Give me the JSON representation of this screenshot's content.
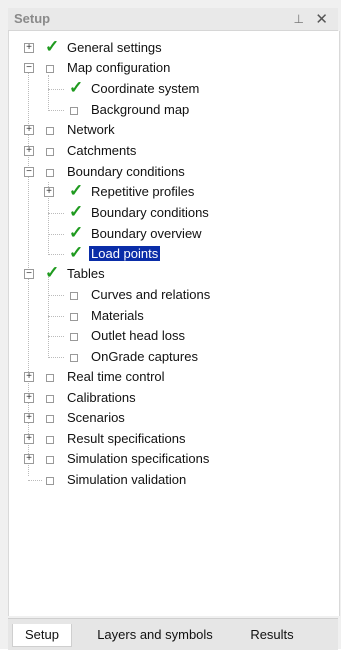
{
  "panel": {
    "title": "Setup",
    "pin_icon": "pin-icon",
    "close_icon": "close-icon"
  },
  "tree": {
    "items": [
      {
        "label": "General settings"
      },
      {
        "label": "Map configuration"
      },
      {
        "label": "Coordinate system"
      },
      {
        "label": "Background map"
      },
      {
        "label": "Network"
      },
      {
        "label": "Catchments"
      },
      {
        "label": "Boundary conditions"
      },
      {
        "label": "Repetitive profiles"
      },
      {
        "label": "Boundary conditions"
      },
      {
        "label": "Boundary overview"
      },
      {
        "label": "Load points"
      },
      {
        "label": "Tables"
      },
      {
        "label": "Curves and relations"
      },
      {
        "label": "Materials"
      },
      {
        "label": "Outlet head loss"
      },
      {
        "label": "OnGrade captures"
      },
      {
        "label": "Real time control"
      },
      {
        "label": "Calibrations"
      },
      {
        "label": "Scenarios"
      },
      {
        "label": "Result specifications"
      },
      {
        "label": "Simulation specifications"
      },
      {
        "label": "Simulation validation"
      }
    ]
  },
  "tabs": [
    {
      "label": "Setup"
    },
    {
      "label": "Layers and symbols"
    },
    {
      "label": "Results"
    }
  ],
  "colors": {
    "selection": "#0a2da8",
    "check": "#1f9a1f"
  }
}
